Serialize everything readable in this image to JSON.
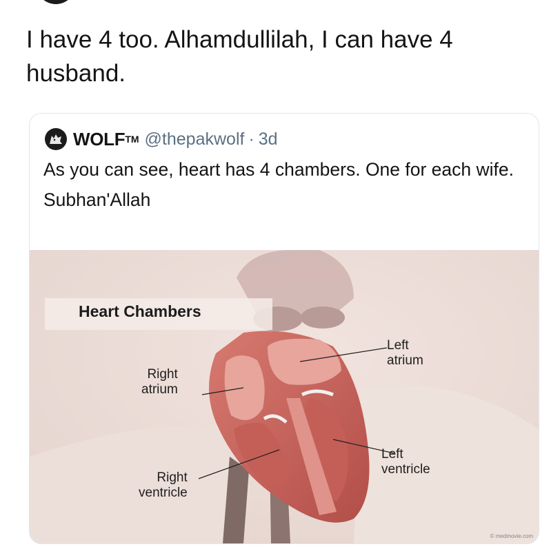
{
  "tweet": {
    "text": "I have 4 too. Alhamdullilah, I can have 4 husband."
  },
  "quoted_tweet": {
    "display_name": "WOLF",
    "trademark": "TM",
    "handle": "@thepakwolf",
    "separator": "·",
    "time": "3d",
    "line1": "As you can see, heart has 4 chambers. One for each wife.",
    "line2": "Subhan'Allah"
  },
  "media": {
    "title": "Heart Chambers",
    "labels": {
      "right_atrium": [
        "Right",
        "atrium"
      ],
      "left_atrium": [
        "Left",
        "atrium"
      ],
      "right_ventricle": [
        "Right",
        "ventricle"
      ],
      "left_ventricle": [
        "Left",
        "ventricle"
      ]
    },
    "watermark": "© medmovie.com"
  },
  "colors": {
    "text": "#141414",
    "muted": "#5b7083",
    "card_border": "#e1e6ea",
    "muscle": "#c9665f",
    "inner_wall": "#e8a39a"
  }
}
